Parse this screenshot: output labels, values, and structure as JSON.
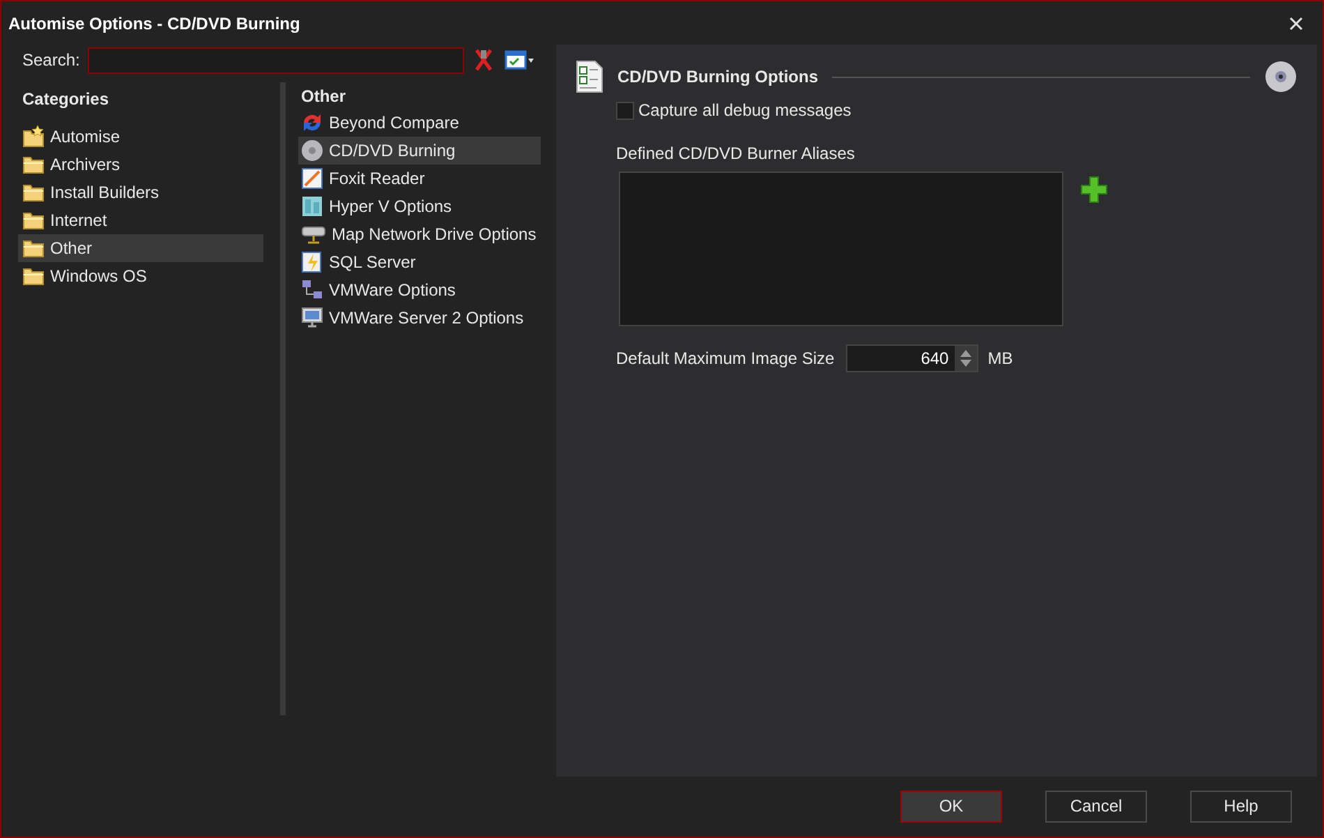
{
  "window": {
    "title": "Automise Options - CD/DVD Burning"
  },
  "search": {
    "label": "Search:"
  },
  "categories": {
    "heading": "Categories",
    "items": [
      {
        "label": "Automise",
        "selected": false
      },
      {
        "label": "Archivers",
        "selected": false
      },
      {
        "label": "Install Builders",
        "selected": false
      },
      {
        "label": "Internet",
        "selected": false
      },
      {
        "label": "Other",
        "selected": true
      },
      {
        "label": "Windows OS",
        "selected": false
      }
    ]
  },
  "pages": {
    "heading": "Other",
    "items": [
      {
        "label": "Beyond Compare",
        "selected": false
      },
      {
        "label": "CD/DVD Burning",
        "selected": true
      },
      {
        "label": "Foxit Reader",
        "selected": false
      },
      {
        "label": "Hyper V Options",
        "selected": false
      },
      {
        "label": "Map Network Drive Options",
        "selected": false
      },
      {
        "label": "SQL Server",
        "selected": false
      },
      {
        "label": "VMWare Options",
        "selected": false
      },
      {
        "label": "VMWare Server 2 Options",
        "selected": false
      }
    ]
  },
  "options": {
    "title": "CD/DVD Burning Options",
    "debug_checkbox": {
      "label": "Capture all debug messages",
      "checked": false
    },
    "aliases_label": "Defined CD/DVD Burner Aliases",
    "image_size": {
      "label": "Default Maximum Image Size",
      "value": "640",
      "unit": "MB"
    }
  },
  "buttons": [
    {
      "label": "OK",
      "selected": true
    },
    {
      "label": "Cancel",
      "selected": false
    },
    {
      "label": "Help",
      "selected": false
    }
  ]
}
